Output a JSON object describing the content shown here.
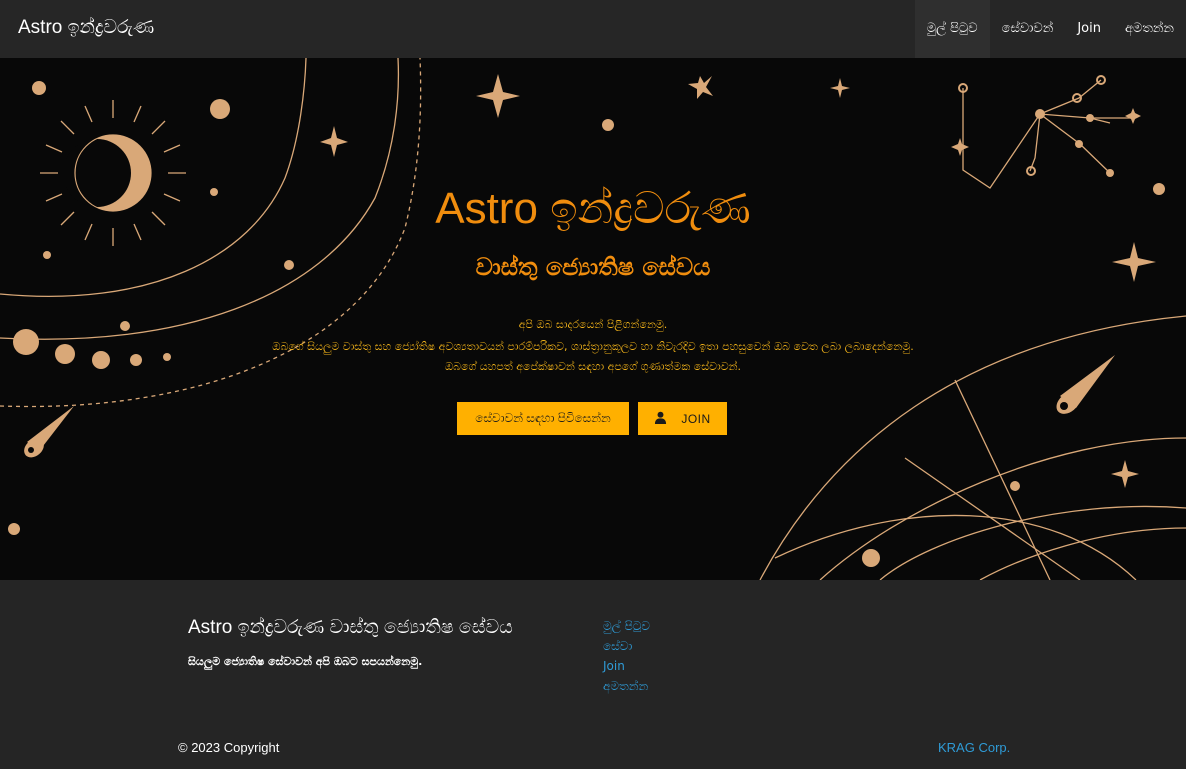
{
  "brand": "Astro ඉන්ද්‍රවරුණ",
  "nav": {
    "items": [
      {
        "label": "මුල් පිටුව"
      },
      {
        "label": "සේවාවන්"
      },
      {
        "label": "Join"
      },
      {
        "label": "අමතන්න"
      }
    ]
  },
  "hero": {
    "title": "Astro ඉන්ද්‍රවරුණ",
    "subtitle": "වාස්තු ජ්‍යොතිෂ සේවය",
    "lines": [
      "අපි ඔබ සාදරයෙන් පිළිගන්නෙමු.",
      "ඔබගේ සියලුම වාස්තු සහ ජ්‍යෝතිෂ අවශ්‍යතාවයන් පාරම්පරිකව, ශාස්ත්‍රානුකූලව හා නිවැරදිව ඉතා පහසුවෙන් ඔබ වෙත ලබා ලබාදෙන්නෙමු.",
      "ඔබගේ යහපත් අපේක්ෂාවන් සඳහා අපගේ ගුණාත්මක සේවාවන්."
    ],
    "btn_services": "සේවාවන් සඳහා පිවිසෙන්න",
    "btn_join": "JOIN"
  },
  "footer": {
    "title": "Astro ඉන්ද්‍රවරුණ වාස්තු ජ්‍යොතිෂ සේවය",
    "desc": "සියලුම ජ්‍යොතිෂ සේවාවන් අපි ඔබට සපයන්නෙමු.",
    "links": [
      {
        "label": "මුල් පිටුව"
      },
      {
        "label": "සේවා"
      },
      {
        "label": "Join"
      },
      {
        "label": "අමතන්න"
      }
    ],
    "copyright": "© 2023 Copyright",
    "credit": "KRAG Corp."
  },
  "colors": {
    "accent": "#f08d0e",
    "button": "#ffb000",
    "line_art": "#d9a878",
    "link": "#2f9bd6"
  },
  "icons": {
    "join_button_icon": "user-icon"
  }
}
